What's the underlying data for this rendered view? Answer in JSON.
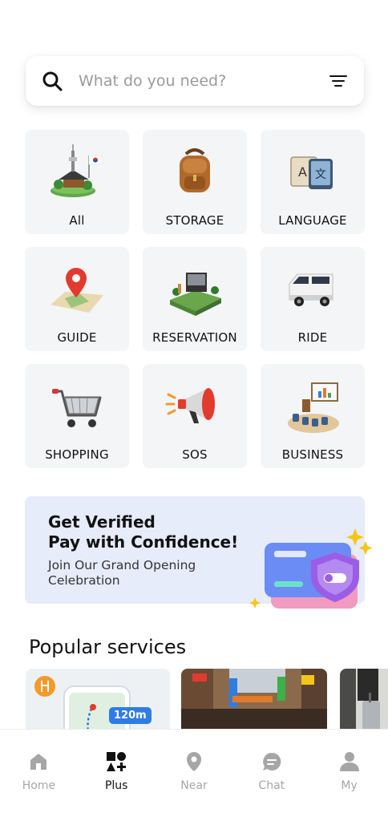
{
  "search": {
    "placeholder": "What do you need?"
  },
  "categories": [
    {
      "label": "All",
      "icon": "seoul-tower-flag-icon"
    },
    {
      "label": "STORAGE",
      "icon": "backpack-icon"
    },
    {
      "label": "LANGUAGE",
      "icon": "translate-icon"
    },
    {
      "label": "GUIDE",
      "icon": "map-pin-icon"
    },
    {
      "label": "RESERVATION",
      "icon": "music-festival-stage-icon"
    },
    {
      "label": "RIDE",
      "icon": "van-icon"
    },
    {
      "label": "SHOPPING",
      "icon": "shopping-cart-icon"
    },
    {
      "label": "SOS",
      "icon": "megaphone-icon"
    },
    {
      "label": "BUSINESS",
      "icon": "presentation-icon"
    }
  ],
  "banner": {
    "title_line1": "Get Verified",
    "title_line2": "Pay with Confidence!",
    "subtitle_line1": "Join Our Grand Opening",
    "subtitle_line2": "Celebration",
    "icon": "card-shield-icon"
  },
  "popular": {
    "title": "Popular services",
    "cards": [
      {
        "badge": "120m",
        "icon": "map-route-icon"
      },
      {
        "icon": "street-market-photo"
      },
      {
        "icon": "traveler-luggage-photo"
      }
    ]
  },
  "tabbar": {
    "items": [
      {
        "label": "Home",
        "icon": "home-icon"
      },
      {
        "label": "Plus",
        "icon": "plus-shapes-icon"
      },
      {
        "label": "Near",
        "icon": "location-pin-icon"
      },
      {
        "label": "Chat",
        "icon": "chat-bubble-icon"
      },
      {
        "label": "My",
        "icon": "person-icon"
      }
    ],
    "active": "Plus"
  },
  "colors": {
    "banner_bg": "#e6ecfa",
    "tile_bg": "#f4f5f7",
    "accent_blue": "#2f7de1",
    "inactive_tab": "#a6a6a6"
  }
}
